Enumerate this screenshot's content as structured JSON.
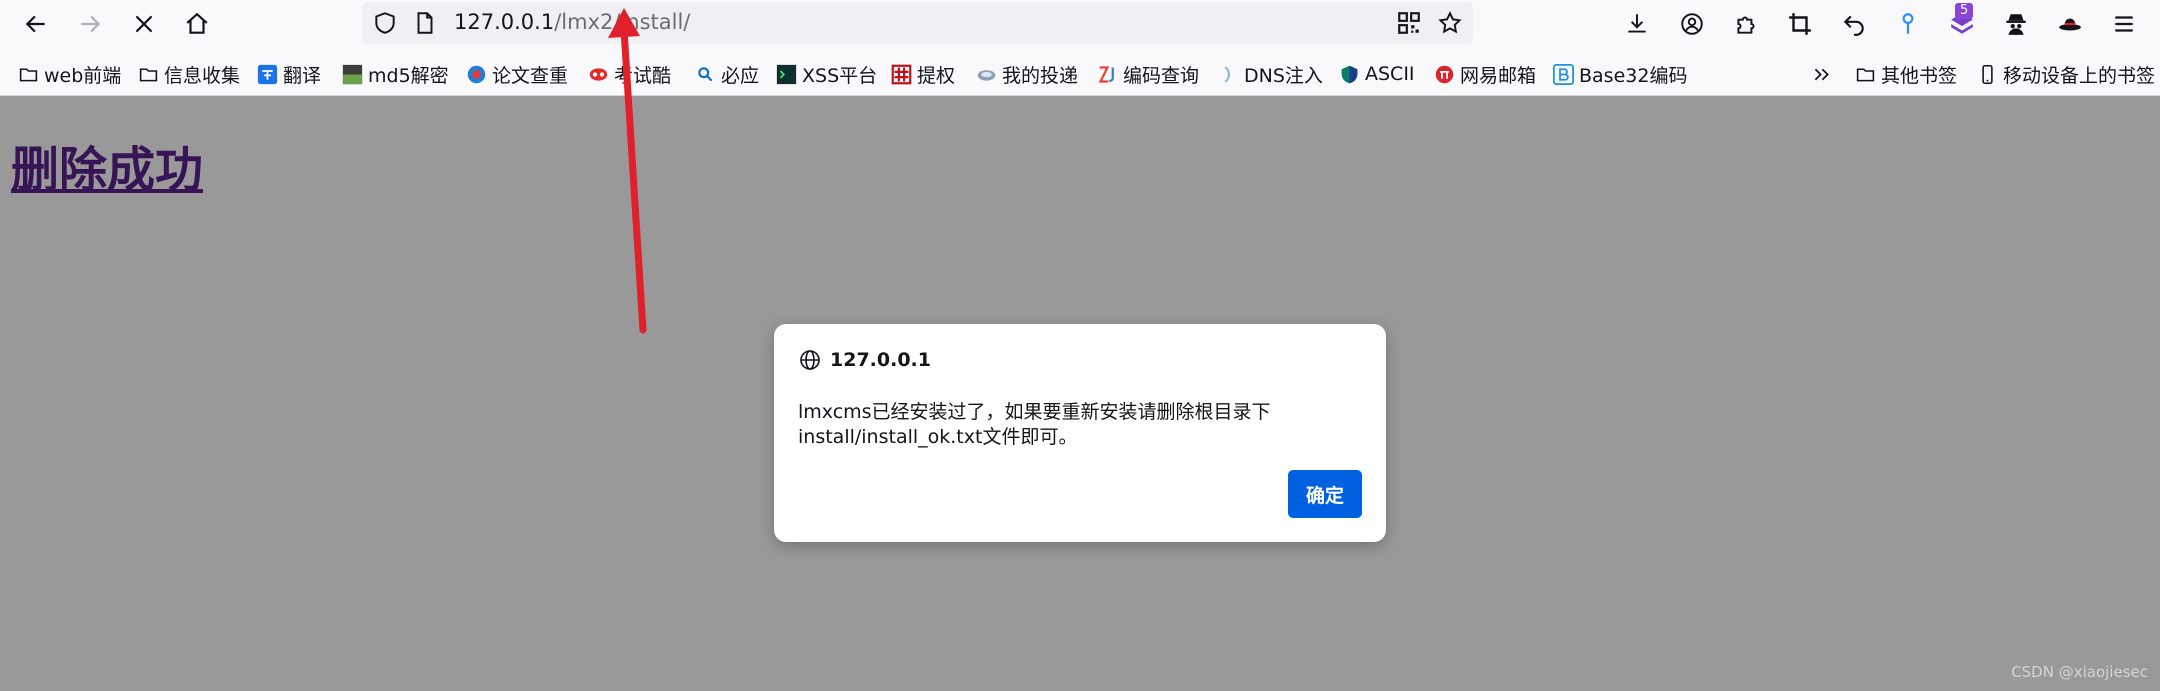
{
  "browser": {
    "url": {
      "host": "127.0.0.1",
      "path": "/lmx2/install/"
    },
    "extension_badge": "5",
    "icons": {
      "back": "arrow-left-icon",
      "forward": "arrow-right-icon",
      "stop": "close-icon",
      "home": "home-icon",
      "shield": "tracking-shield-icon",
      "page": "page-icon",
      "qr": "qr-code-icon",
      "bookmark_star": "star-icon",
      "downloads": "download-icon",
      "account": "account-icon",
      "extensions": "puzzle-icon",
      "screenshot": "crop-icon",
      "undo": "undo-icon",
      "pin": "pin-icon",
      "ext_stack": "layers-icon",
      "spy": "spy-icon",
      "hat": "hat-icon",
      "menu": "hamburger-menu-icon"
    }
  },
  "bookmarks": {
    "items": [
      {
        "label": "web前端",
        "icon": "folder-icon"
      },
      {
        "label": "信息收集",
        "icon": "folder-icon"
      },
      {
        "label": "翻译",
        "icon": "translate-icon"
      },
      {
        "label": "md5解密",
        "icon": "md5-icon"
      },
      {
        "label": "论文查重",
        "icon": "globe-icon"
      },
      {
        "label": "考试酷",
        "icon": "eyes-icon"
      },
      {
        "label": "必应",
        "icon": "search-icon"
      },
      {
        "label": "XSS平台",
        "icon": "terminal-icon"
      },
      {
        "label": "提权",
        "icon": "hash-icon"
      },
      {
        "label": "我的投递",
        "icon": "cloud-icon"
      },
      {
        "label": "编码查询",
        "icon": "zj-icon"
      },
      {
        "label": "DNS注入",
        "icon": "dns-icon"
      },
      {
        "label": "ASCII",
        "icon": "shield-logo-icon"
      },
      {
        "label": "网易邮箱",
        "icon": "netease-icon"
      },
      {
        "label": "Base32编码",
        "icon": "b-icon"
      }
    ],
    "overflow_icon": "double-chevron-icon",
    "other": "其他书签",
    "mobile": "移动设备上的书签"
  },
  "page": {
    "heading": "删除成功"
  },
  "dialog": {
    "origin": "127.0.0.1",
    "message": "lmxcms已经安装过了，如果要重新安装请删除根目录下install/install_ok.txt文件即可。",
    "ok_label": "确定",
    "icon": "globe-icon"
  },
  "watermark": "CSDN @xiaojiesec",
  "colors": {
    "accent": "#0061e0",
    "visited_link": "#551a8b",
    "annotation_arrow": "#e0202a"
  }
}
